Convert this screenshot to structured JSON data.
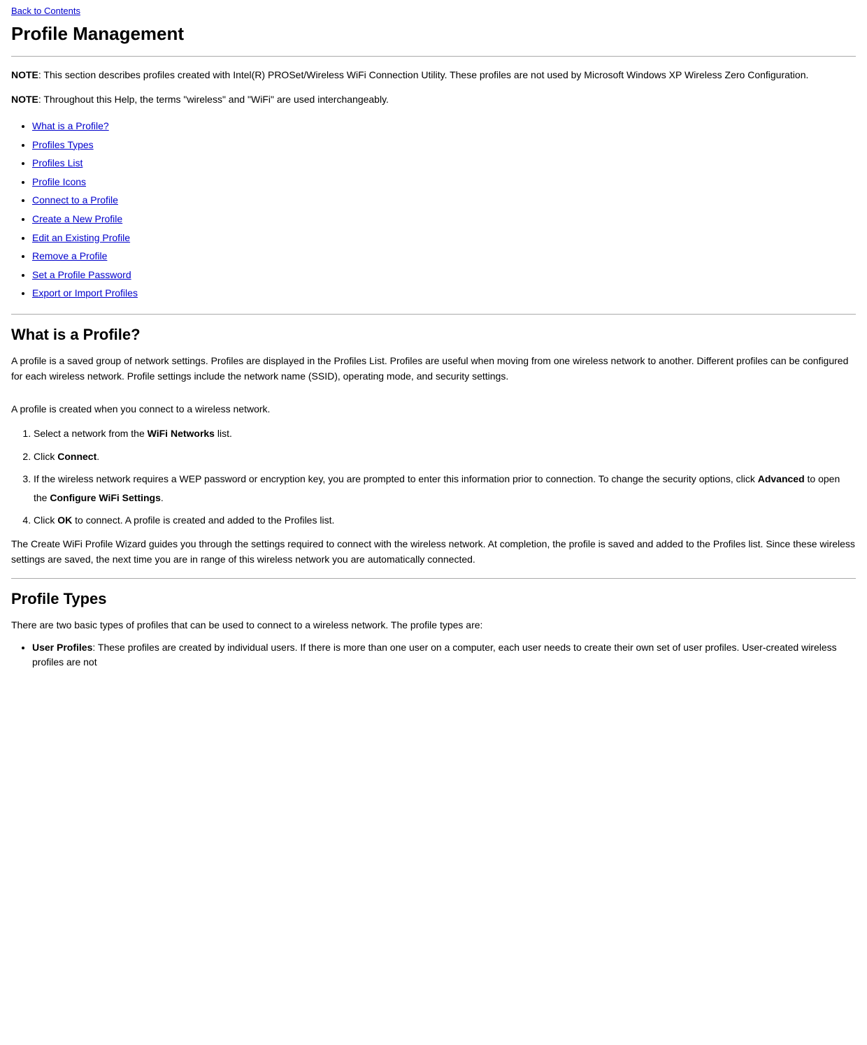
{
  "back_link": {
    "label": "Back to Contents",
    "href": "#"
  },
  "page_title": "Profile Management",
  "notes": [
    {
      "id": "note1",
      "label": "NOTE",
      "text": ": This section describes profiles created with Intel(R) PROSet/Wireless WiFi Connection Utility. These profiles are not used by Microsoft Windows XP Wireless Zero Configuration."
    },
    {
      "id": "note2",
      "label": "NOTE",
      "text": ": Throughout this Help, the terms \"wireless\" and \"WiFi\" are used interchangeably."
    }
  ],
  "toc": {
    "items": [
      {
        "label": "What is a Profile?",
        "href": "#what-is-a-profile"
      },
      {
        "label": "Profiles Types",
        "href": "#profile-types"
      },
      {
        "label": "Profiles List",
        "href": "#profiles-list"
      },
      {
        "label": "Profile Icons",
        "href": "#profile-icons"
      },
      {
        "label": "Connect to a Profile",
        "href": "#connect-to-a-profile"
      },
      {
        "label": "Create a New Profile",
        "href": "#create-a-new-profile"
      },
      {
        "label": "Edit an Existing Profile",
        "href": "#edit-an-existing-profile"
      },
      {
        "label": "Remove a Profile",
        "href": "#remove-a-profile"
      },
      {
        "label": "Set a Profile Password",
        "href": "#set-a-profile-password"
      },
      {
        "label": "Export or Import Profiles",
        "href": "#export-or-import-profiles"
      }
    ]
  },
  "sections": [
    {
      "id": "what-is-a-profile",
      "heading": "What is a Profile?",
      "paragraphs": [
        "A profile is a saved group of network settings. Profiles are displayed in the Profiles List. Profiles are useful when moving from one wireless network to another. Different profiles can be configured for each wireless network. Profile settings include the network name (SSID), operating mode, and security settings.",
        "A profile is created when you connect to a wireless network."
      ],
      "steps": [
        {
          "html": "Select a network from the <strong>WiFi Networks</strong> list."
        },
        {
          "html": "Click <strong>Connect</strong>."
        },
        {
          "html": "If the wireless network requires a WEP password or encryption key, you are prompted to enter this information prior to connection. To change the security options, click <strong>Advanced</strong> to open the <strong>Configure WiFi Settings</strong>."
        },
        {
          "html": "Click <strong>OK</strong> to connect. A profile is created and added to the Profiles list."
        }
      ],
      "closing_paragraph": "The Create WiFi Profile Wizard guides you through the settings required to connect with the wireless network. At completion, the profile is saved and added to the Profiles list. Since these wireless settings are saved, the next time you are in range of this wireless network you are automatically connected."
    },
    {
      "id": "profile-types",
      "heading": "Profile Types",
      "intro": "There are two basic types of profiles that can be used to connect to a wireless network. The profile types are:",
      "bullet_items": [
        {
          "html": "<strong>User Profiles</strong>: These profiles are created by individual users. If there is more than one user on a computer, each user needs to create their own set of user profiles. User-created wireless profiles are not"
        }
      ]
    }
  ]
}
